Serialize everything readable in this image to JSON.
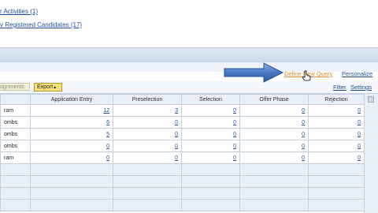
{
  "top_links": [
    {
      "label": "r Activities (1)"
    },
    {
      "label": "v Registered Candidates (17)"
    }
  ],
  "query_bar": {
    "define_query": "Define New Query",
    "personalize": "Personalize"
  },
  "toolbar": {
    "assignments": "signments",
    "export": "Export",
    "filter": "Filter",
    "settings": "Settings"
  },
  "table": {
    "columns": [
      "",
      "Application Entry",
      "Preselection",
      "Selection",
      "Offer Phase",
      "Rejection"
    ],
    "rows": [
      [
        "ram",
        "12",
        "3",
        "0",
        "0",
        "0"
      ],
      [
        "ombs",
        "6",
        "0",
        "0",
        "0",
        "0"
      ],
      [
        "ombs",
        "5",
        "0",
        "0",
        "0",
        "0"
      ],
      [
        "ombs",
        "0",
        "0",
        "0",
        "0",
        "0"
      ],
      [
        "ram",
        "0",
        "0",
        "0",
        "0",
        "0"
      ]
    ],
    "empty_rows": 4
  },
  "colors": {
    "link": "#1f4e9c",
    "define_link": "#e3872c",
    "arrow": "#4a78c6",
    "export_button": "#f5e27a"
  }
}
